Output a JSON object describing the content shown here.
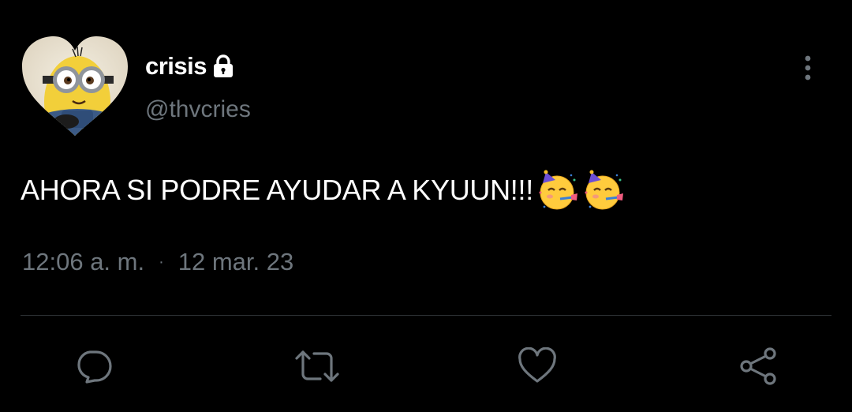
{
  "tweet": {
    "author": {
      "display_name": "crisis",
      "handle": "@thvcries",
      "avatar_icon": "minion-heart-avatar",
      "protected_icon": "lock-icon"
    },
    "text": "AHORA SI PODRE AYUDAR A KYUUN!!!",
    "emojis": [
      "partying-face-emoji",
      "partying-face-emoji"
    ],
    "time": "12:06 a. m.",
    "separator": "·",
    "date": "12 mar. 23",
    "more_icon": "more-vertical-icon"
  },
  "actions": [
    {
      "name": "reply",
      "icon": "reply-icon"
    },
    {
      "name": "retweet",
      "icon": "retweet-icon"
    },
    {
      "name": "like",
      "icon": "heart-icon"
    },
    {
      "name": "share",
      "icon": "share-icon"
    }
  ],
  "colors": {
    "background": "#000000",
    "primary_text": "#ffffff",
    "secondary_text": "#6e767d",
    "divider": "#2f3336"
  }
}
